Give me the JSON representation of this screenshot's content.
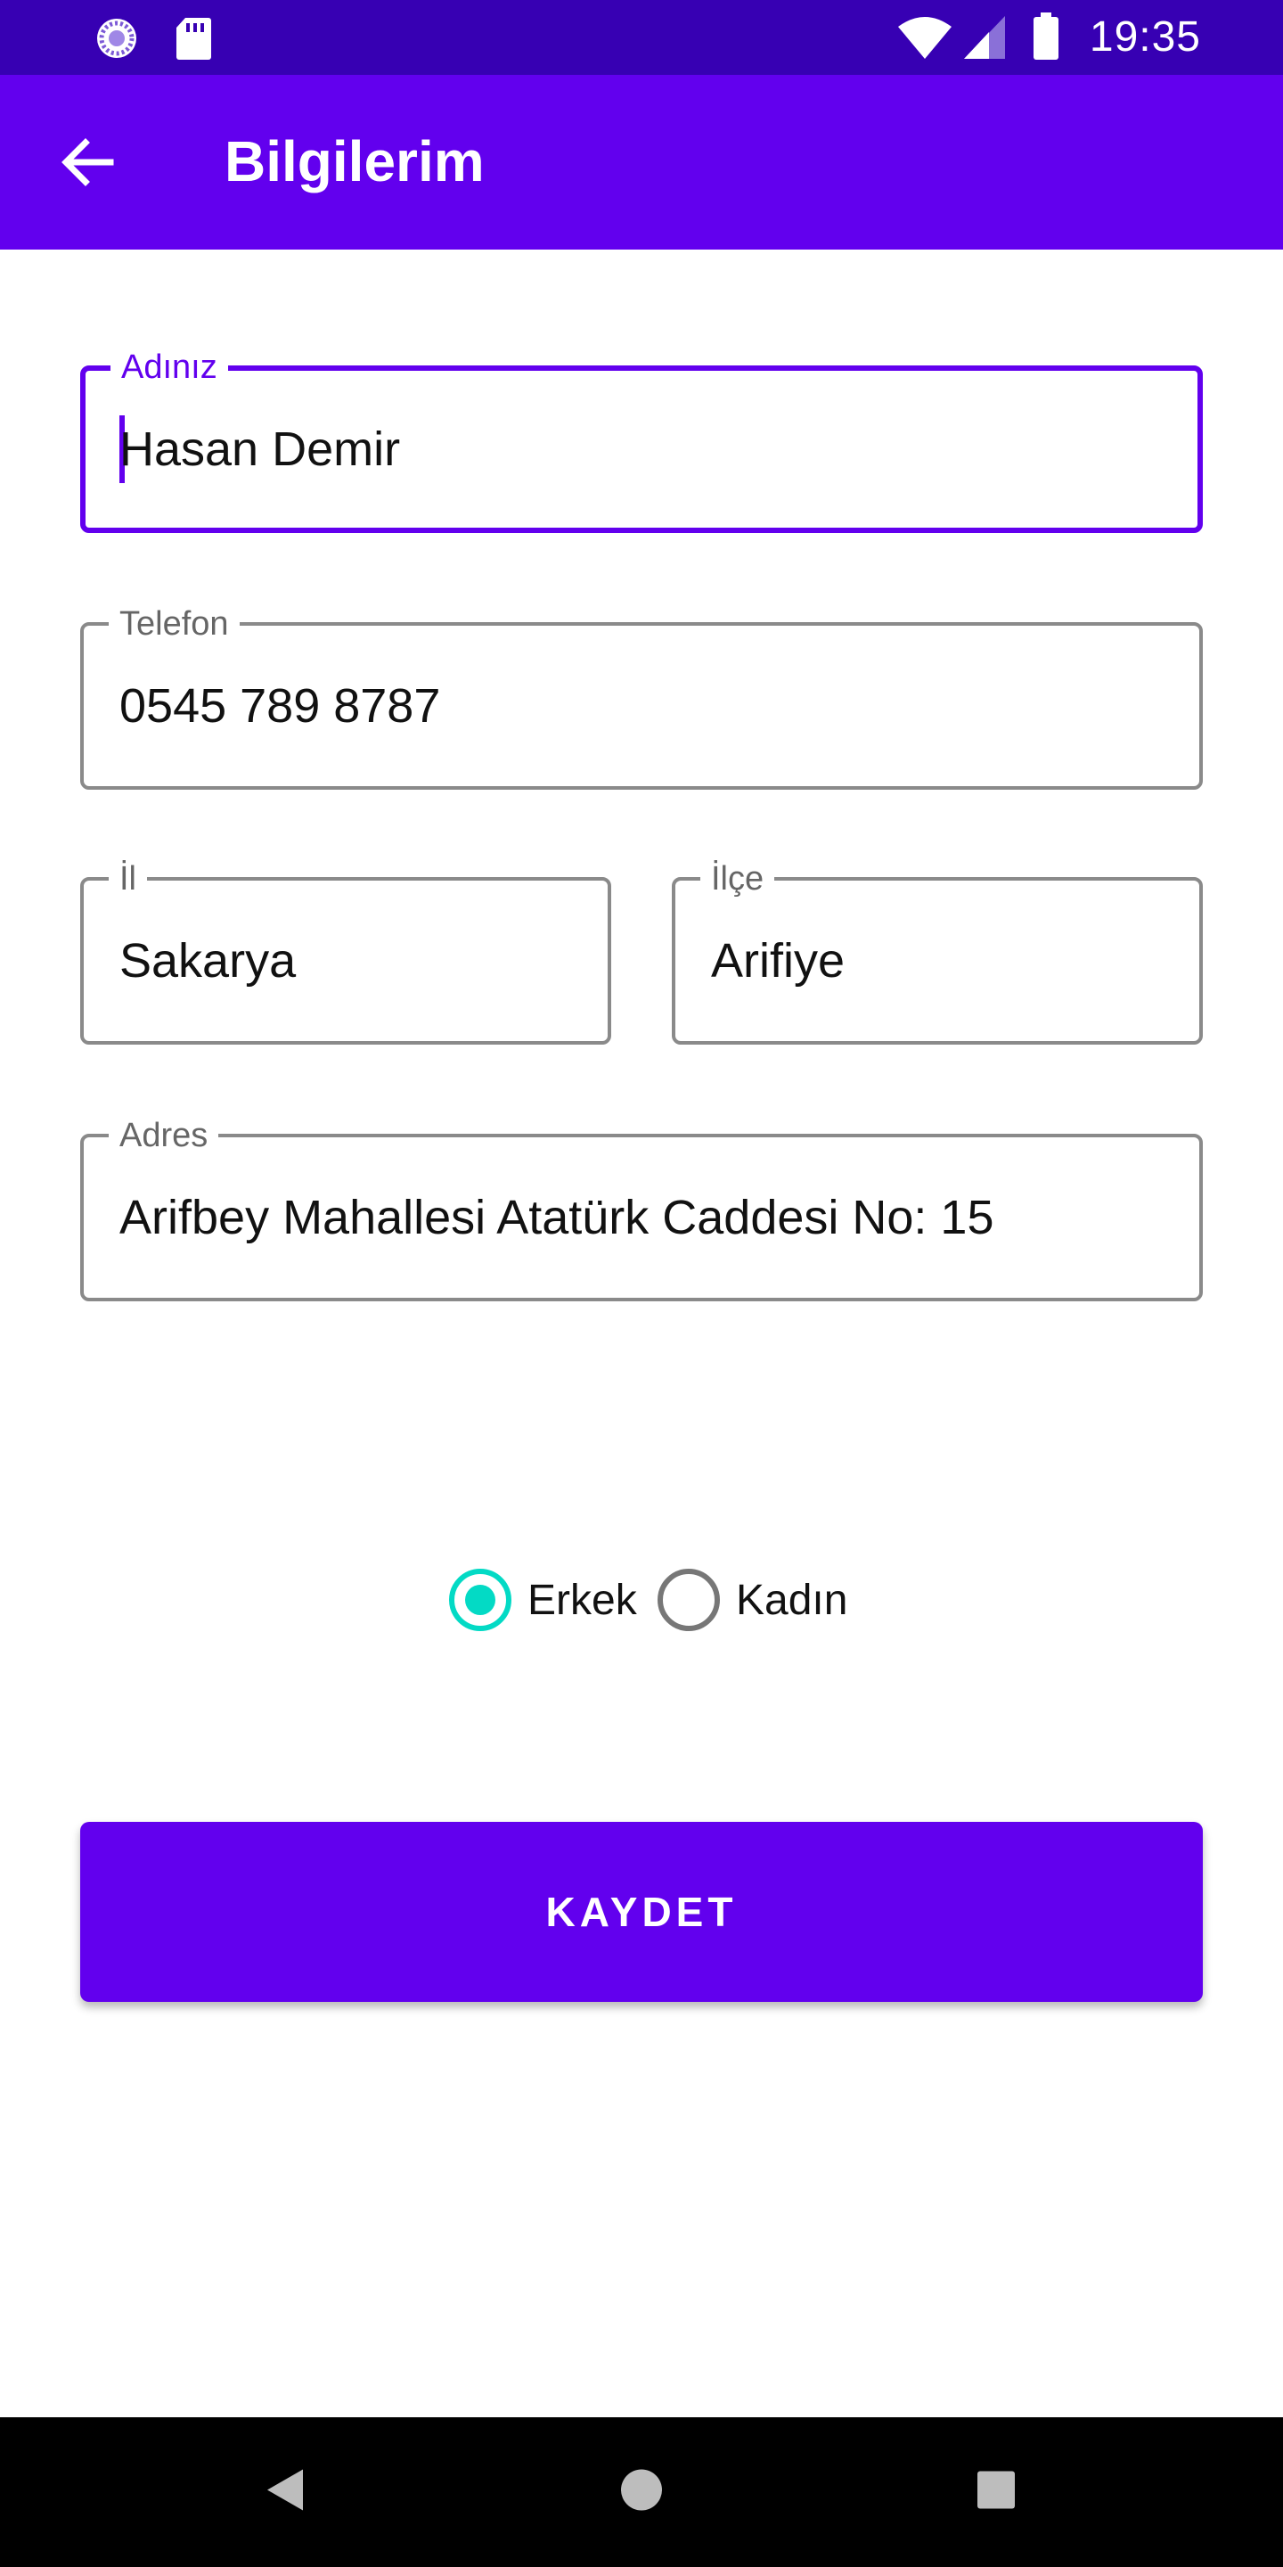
{
  "status_bar": {
    "time": "19:35",
    "icons": [
      "circle-badge-icon",
      "sd-card-icon",
      "wifi-icon",
      "signal-icon",
      "battery-icon"
    ]
  },
  "app_bar": {
    "title": "Bilgilerim",
    "back_icon": "arrow-left-icon"
  },
  "form": {
    "name": {
      "label": "Adınız",
      "value": "Hasan Demir"
    },
    "phone": {
      "label": "Telefon",
      "value": "0545 789 8787"
    },
    "city": {
      "label": "İl",
      "value": "Sakarya"
    },
    "district": {
      "label": "İlçe",
      "value": "Arifiye"
    },
    "address": {
      "label": "Adres",
      "value": "Arifbey Mahallesi Atatürk Caddesi No: 15"
    }
  },
  "gender": {
    "options": [
      {
        "label": "Erkek",
        "selected": true
      },
      {
        "label": "Kadın",
        "selected": false
      }
    ]
  },
  "save_button": {
    "label": "KAYDET"
  },
  "nav_bar": {
    "icons": [
      "back-triangle-icon",
      "home-circle-icon",
      "recents-square-icon"
    ]
  },
  "colors": {
    "primary": "#6200ee",
    "primary_dark": "#3700b3",
    "accent": "#03dac5"
  }
}
